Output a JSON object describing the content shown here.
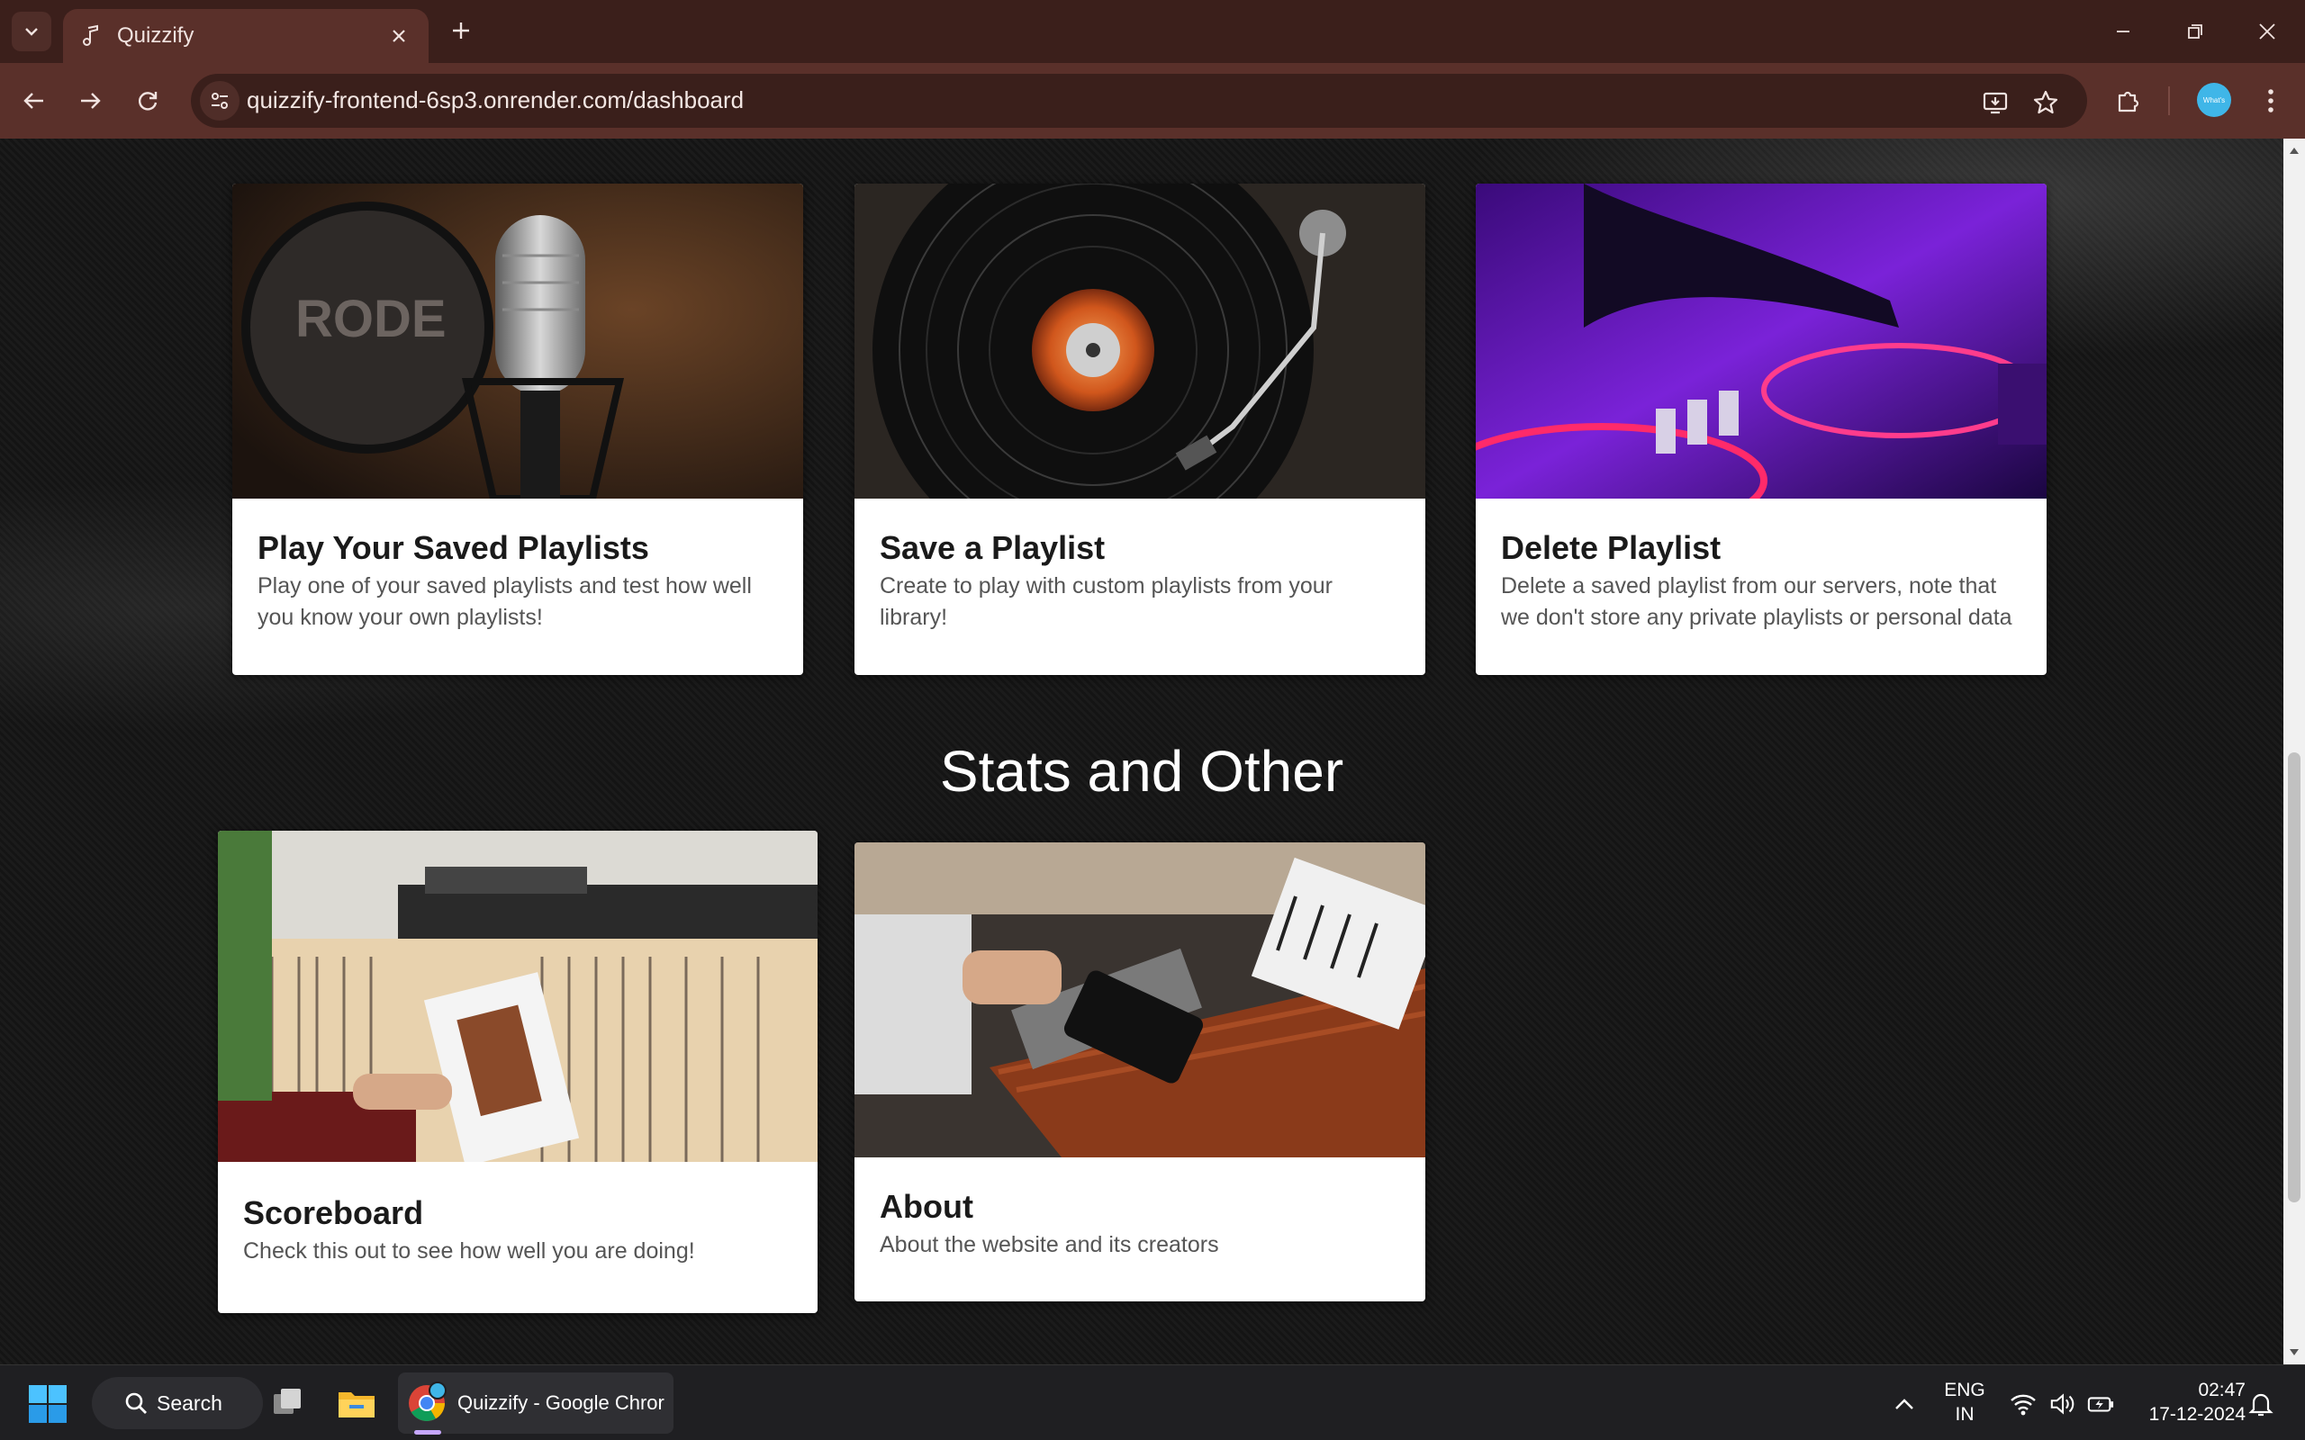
{
  "browser": {
    "tab_title": "Quizzify",
    "url": "quizzify-frontend-6sp3.onrender.com/dashboard",
    "profile_label": "What's"
  },
  "top_cards": [
    {
      "title": "Play Your Saved Playlists",
      "description": "Play one of your saved playlists and test how well you know your own playlists!"
    },
    {
      "title": "Save a Playlist",
      "description": "Create to play with custom playlists from your library!"
    },
    {
      "title": "Delete Playlist",
      "description": "Delete a saved playlist from our servers, note that we don't store any private playlists or personal data"
    }
  ],
  "section": {
    "title": "Stats and Other"
  },
  "bottom_cards": [
    {
      "title": "Scoreboard",
      "description": "Check this out to see how well you are doing!"
    },
    {
      "title": "About",
      "description": "About the website and its creators"
    }
  ],
  "taskbar": {
    "search_label": "Search",
    "chrome_task_label": "Quizzify - Google Chror",
    "language_line1": "ENG",
    "language_line2": "IN",
    "time": "02:47",
    "date": "17-12-2024"
  },
  "colors": {
    "chrome_dark": "#3b1f1b",
    "chrome_toolbar": "#5a302a",
    "card_bg": "#ffffff"
  }
}
